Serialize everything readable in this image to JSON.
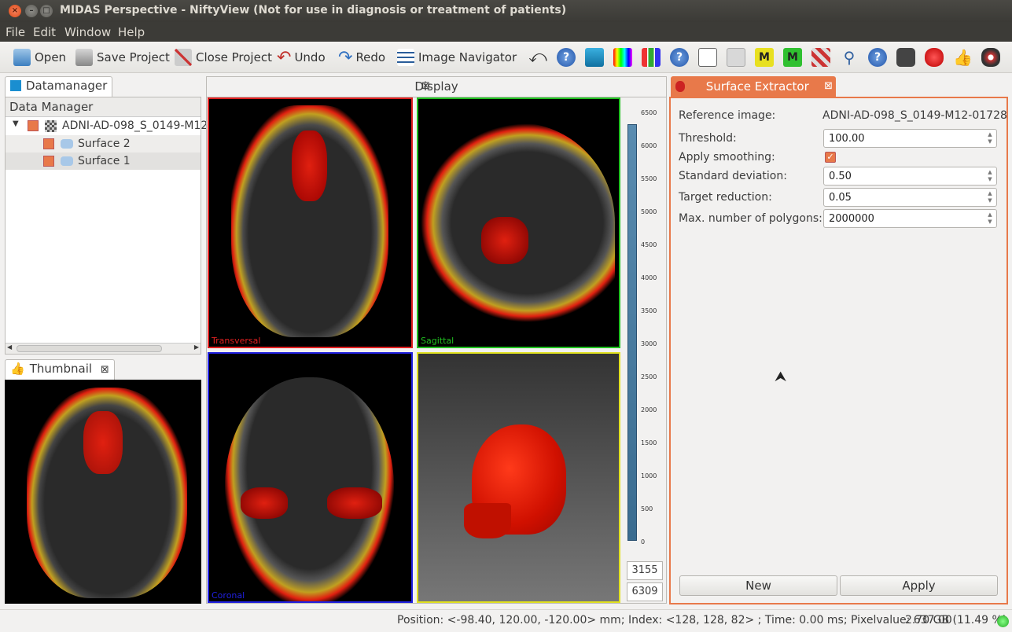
{
  "window": {
    "title": "MIDAS Perspective - NiftyView (Not for use in diagnosis or treatment of patients)"
  },
  "menu": [
    "File",
    "Edit",
    "Window",
    "Help"
  ],
  "toolbar": {
    "open": "Open",
    "save": "Save Project",
    "close": "Close Project",
    "undo": "Undo",
    "redo": "Redo",
    "navigator": "Image Navigator"
  },
  "datamanager": {
    "tab": "Datamanager",
    "header": "Data Manager",
    "items": [
      {
        "label": "ADNI-AD-098_S_0149-M12"
      },
      {
        "label": "Surface 2"
      },
      {
        "label": "Surface 1"
      }
    ]
  },
  "thumbnail": {
    "tab": "Thumbnail"
  },
  "display": {
    "tab": "Display",
    "views": {
      "transversal": "Transversal",
      "sagittal": "Sagittal",
      "coronal": "Coronal"
    },
    "scale": {
      "ticks": [
        "6500",
        "6000",
        "5500",
        "5000",
        "4500",
        "4000",
        "3500",
        "3000",
        "2500",
        "2000",
        "1500",
        "1000",
        "500",
        "0"
      ],
      "level": "3155",
      "window": "6309"
    }
  },
  "surface": {
    "tab": "Surface Extractor",
    "ref_label": "Reference image:",
    "ref_value": "ADNI-AD-098_S_0149-M12-01728",
    "threshold_label": "Threshold:",
    "threshold": "100.00",
    "smoothing_label": "Apply smoothing:",
    "smoothing": true,
    "sd_label": "Standard deviation:",
    "sd": "0.50",
    "reduction_label": "Target reduction:",
    "reduction": "0.05",
    "poly_label": "Max. number of polygons:",
    "poly": "2000000",
    "new": "New",
    "apply": "Apply"
  },
  "status": {
    "text": "Position: <-98.40, 120.00, -120.00> mm; Index: <128, 128, 82> ; Time: 0.00 ms; Pixelvalue: 637.00",
    "memory": "2.70 GB (11.49 %)"
  },
  "colors": {
    "transversal": "#e02020",
    "sagittal": "#20c020",
    "coronal": "#2020e0",
    "render": "#e0e020",
    "accent": "#e8794a"
  }
}
